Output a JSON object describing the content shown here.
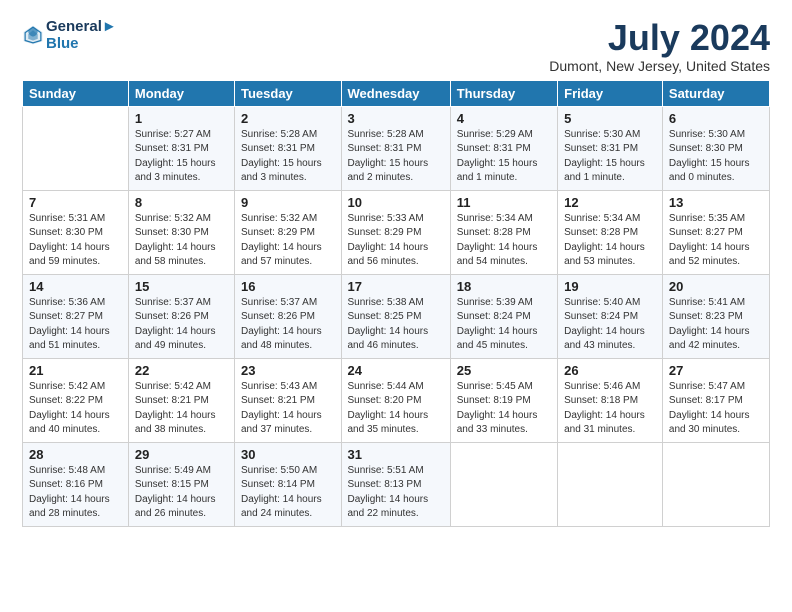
{
  "header": {
    "logo_line1": "General",
    "logo_line2": "Blue",
    "title": "July 2024",
    "subtitle": "Dumont, New Jersey, United States"
  },
  "weekdays": [
    "Sunday",
    "Monday",
    "Tuesday",
    "Wednesday",
    "Thursday",
    "Friday",
    "Saturday"
  ],
  "weeks": [
    [
      {
        "day": "",
        "content": ""
      },
      {
        "day": "1",
        "content": "Sunrise: 5:27 AM\nSunset: 8:31 PM\nDaylight: 15 hours\nand 3 minutes."
      },
      {
        "day": "2",
        "content": "Sunrise: 5:28 AM\nSunset: 8:31 PM\nDaylight: 15 hours\nand 3 minutes."
      },
      {
        "day": "3",
        "content": "Sunrise: 5:28 AM\nSunset: 8:31 PM\nDaylight: 15 hours\nand 2 minutes."
      },
      {
        "day": "4",
        "content": "Sunrise: 5:29 AM\nSunset: 8:31 PM\nDaylight: 15 hours\nand 1 minute."
      },
      {
        "day": "5",
        "content": "Sunrise: 5:30 AM\nSunset: 8:31 PM\nDaylight: 15 hours\nand 1 minute."
      },
      {
        "day": "6",
        "content": "Sunrise: 5:30 AM\nSunset: 8:30 PM\nDaylight: 15 hours\nand 0 minutes."
      }
    ],
    [
      {
        "day": "7",
        "content": "Sunrise: 5:31 AM\nSunset: 8:30 PM\nDaylight: 14 hours\nand 59 minutes."
      },
      {
        "day": "8",
        "content": "Sunrise: 5:32 AM\nSunset: 8:30 PM\nDaylight: 14 hours\nand 58 minutes."
      },
      {
        "day": "9",
        "content": "Sunrise: 5:32 AM\nSunset: 8:29 PM\nDaylight: 14 hours\nand 57 minutes."
      },
      {
        "day": "10",
        "content": "Sunrise: 5:33 AM\nSunset: 8:29 PM\nDaylight: 14 hours\nand 56 minutes."
      },
      {
        "day": "11",
        "content": "Sunrise: 5:34 AM\nSunset: 8:28 PM\nDaylight: 14 hours\nand 54 minutes."
      },
      {
        "day": "12",
        "content": "Sunrise: 5:34 AM\nSunset: 8:28 PM\nDaylight: 14 hours\nand 53 minutes."
      },
      {
        "day": "13",
        "content": "Sunrise: 5:35 AM\nSunset: 8:27 PM\nDaylight: 14 hours\nand 52 minutes."
      }
    ],
    [
      {
        "day": "14",
        "content": "Sunrise: 5:36 AM\nSunset: 8:27 PM\nDaylight: 14 hours\nand 51 minutes."
      },
      {
        "day": "15",
        "content": "Sunrise: 5:37 AM\nSunset: 8:26 PM\nDaylight: 14 hours\nand 49 minutes."
      },
      {
        "day": "16",
        "content": "Sunrise: 5:37 AM\nSunset: 8:26 PM\nDaylight: 14 hours\nand 48 minutes."
      },
      {
        "day": "17",
        "content": "Sunrise: 5:38 AM\nSunset: 8:25 PM\nDaylight: 14 hours\nand 46 minutes."
      },
      {
        "day": "18",
        "content": "Sunrise: 5:39 AM\nSunset: 8:24 PM\nDaylight: 14 hours\nand 45 minutes."
      },
      {
        "day": "19",
        "content": "Sunrise: 5:40 AM\nSunset: 8:24 PM\nDaylight: 14 hours\nand 43 minutes."
      },
      {
        "day": "20",
        "content": "Sunrise: 5:41 AM\nSunset: 8:23 PM\nDaylight: 14 hours\nand 42 minutes."
      }
    ],
    [
      {
        "day": "21",
        "content": "Sunrise: 5:42 AM\nSunset: 8:22 PM\nDaylight: 14 hours\nand 40 minutes."
      },
      {
        "day": "22",
        "content": "Sunrise: 5:42 AM\nSunset: 8:21 PM\nDaylight: 14 hours\nand 38 minutes."
      },
      {
        "day": "23",
        "content": "Sunrise: 5:43 AM\nSunset: 8:21 PM\nDaylight: 14 hours\nand 37 minutes."
      },
      {
        "day": "24",
        "content": "Sunrise: 5:44 AM\nSunset: 8:20 PM\nDaylight: 14 hours\nand 35 minutes."
      },
      {
        "day": "25",
        "content": "Sunrise: 5:45 AM\nSunset: 8:19 PM\nDaylight: 14 hours\nand 33 minutes."
      },
      {
        "day": "26",
        "content": "Sunrise: 5:46 AM\nSunset: 8:18 PM\nDaylight: 14 hours\nand 31 minutes."
      },
      {
        "day": "27",
        "content": "Sunrise: 5:47 AM\nSunset: 8:17 PM\nDaylight: 14 hours\nand 30 minutes."
      }
    ],
    [
      {
        "day": "28",
        "content": "Sunrise: 5:48 AM\nSunset: 8:16 PM\nDaylight: 14 hours\nand 28 minutes."
      },
      {
        "day": "29",
        "content": "Sunrise: 5:49 AM\nSunset: 8:15 PM\nDaylight: 14 hours\nand 26 minutes."
      },
      {
        "day": "30",
        "content": "Sunrise: 5:50 AM\nSunset: 8:14 PM\nDaylight: 14 hours\nand 24 minutes."
      },
      {
        "day": "31",
        "content": "Sunrise: 5:51 AM\nSunset: 8:13 PM\nDaylight: 14 hours\nand 22 minutes."
      },
      {
        "day": "",
        "content": ""
      },
      {
        "day": "",
        "content": ""
      },
      {
        "day": "",
        "content": ""
      }
    ]
  ]
}
